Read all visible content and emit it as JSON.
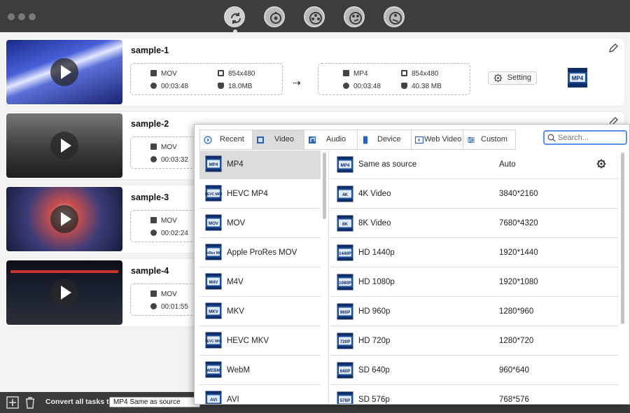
{
  "toolbar": {
    "modes": [
      "convert-mode",
      "compress-mode",
      "merge-mode",
      "edit-mode",
      "download-mode"
    ]
  },
  "tasks": [
    {
      "title": "sample-1",
      "src_format": "MOV",
      "src_resolution": "854x480",
      "src_duration": "00:03:48",
      "src_size": "18.0MB",
      "dst_format": "MP4",
      "dst_resolution": "854x480",
      "dst_duration": "00:03:48",
      "dst_size": "40.38 MB",
      "setting_label": "Setting",
      "badge": "MP4"
    },
    {
      "title": "sample-2",
      "src_format": "MOV",
      "src_duration": "00:03:32"
    },
    {
      "title": "sample-3",
      "src_format": "MOV",
      "src_duration": "00:02:24"
    },
    {
      "title": "sample-4",
      "src_format": "MOV",
      "src_duration": "00:01:55"
    }
  ],
  "bottom": {
    "convert_label": "Convert all tasks to",
    "convert_value": "MP4 Same as source"
  },
  "popup": {
    "tabs": [
      {
        "label": "Recent",
        "icon": "recent-icon"
      },
      {
        "label": "Video",
        "icon": "video-icon"
      },
      {
        "label": "Audio",
        "icon": "audio-icon"
      },
      {
        "label": "Device",
        "icon": "device-icon"
      },
      {
        "label": "Web Video",
        "icon": "web-video-icon"
      },
      {
        "label": "Custom",
        "icon": "custom-icon"
      }
    ],
    "active_tab": "Video",
    "search_placeholder": "Search...",
    "formats": [
      {
        "label": "MP4",
        "badge": "MP4"
      },
      {
        "label": "HEVC MP4",
        "badge": "HEVC MP4"
      },
      {
        "label": "MOV",
        "badge": "MOV"
      },
      {
        "label": "Apple ProRes MOV",
        "badge": "ProRes MOV"
      },
      {
        "label": "M4V",
        "badge": "M4V"
      },
      {
        "label": "MKV",
        "badge": "MKV"
      },
      {
        "label": "HEVC MKV",
        "badge": "HEVC MKV"
      },
      {
        "label": "WebM",
        "badge": "WEBM"
      },
      {
        "label": "AVI",
        "badge": "AVI"
      }
    ],
    "selected_format": "MP4",
    "resolutions": [
      {
        "label": "Same as source",
        "value": "Auto",
        "badge": "MP4"
      },
      {
        "label": "4K Video",
        "value": "3840*2160",
        "badge": "4K"
      },
      {
        "label": "8K Video",
        "value": "7680*4320",
        "badge": "8K"
      },
      {
        "label": "HD 1440p",
        "value": "1920*1440",
        "badge": "1440P"
      },
      {
        "label": "HD 1080p",
        "value": "1920*1080",
        "badge": "1080P"
      },
      {
        "label": "HD 960p",
        "value": "1280*960",
        "badge": "960P"
      },
      {
        "label": "HD 720p",
        "value": "1280*720",
        "badge": "720P"
      },
      {
        "label": "SD 640p",
        "value": "960*640",
        "badge": "640P"
      },
      {
        "label": "SD 576p",
        "value": "768*576",
        "badge": "576P"
      }
    ]
  },
  "colors": {
    "accent": "#5b93e6",
    "titlebar": "#3d3d3d",
    "selected_row": "#dcdcdc"
  }
}
